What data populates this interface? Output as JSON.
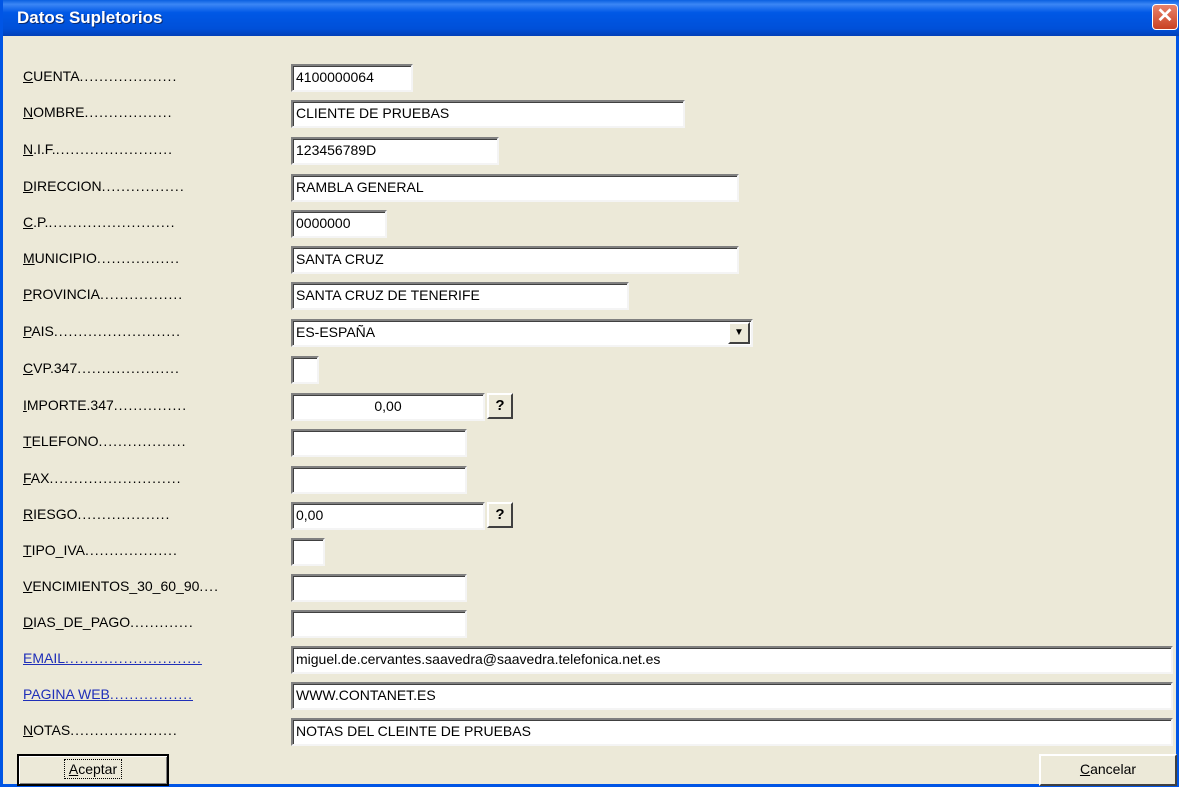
{
  "window": {
    "title": "Datos Supletorios",
    "close_label": "✕"
  },
  "fields": {
    "cuenta": {
      "key": "C",
      "rest": "UENTA",
      "dots": "....................",
      "value": "4100000064"
    },
    "nombre": {
      "key": "N",
      "rest": "OMBRE",
      "dots": "..................",
      "value": "CLIENTE DE PRUEBAS"
    },
    "nif": {
      "key": "N",
      "rest": ".I.F.",
      "dots": "........................",
      "value": "123456789D"
    },
    "direccion": {
      "key": "D",
      "rest": "IRECCION",
      "dots": ".................",
      "value": "RAMBLA GENERAL"
    },
    "cp": {
      "key": "C",
      "rest": ".P.",
      "dots": "..........................",
      "value": "0000000"
    },
    "municipio": {
      "key": "M",
      "rest": "UNICIPIO",
      "dots": ".................",
      "value": "SANTA CRUZ"
    },
    "provincia": {
      "key": "P",
      "rest": "ROVINCIA",
      "dots": ".................",
      "value": "SANTA CRUZ DE TENERIFE"
    },
    "pais": {
      "key": "P",
      "rest": "AIS",
      "dots": "..........................",
      "value": "ES-ESPAÑA",
      "dropdown_icon": "▼"
    },
    "cvp347": {
      "key": "C",
      "rest": "VP.347",
      "dots": ".....................",
      "value": ""
    },
    "importe347": {
      "key": "I",
      "rest": "MPORTE.347",
      "dots": "...............",
      "value": "0,00",
      "help": "?"
    },
    "telefono": {
      "key": "T",
      "rest": "ELEFONO",
      "dots": "..................",
      "value": ""
    },
    "fax": {
      "key": "F",
      "rest": "AX",
      "dots": "...........................",
      "value": ""
    },
    "riesgo": {
      "key": "R",
      "rest": "IESGO",
      "dots": "...................",
      "value": "0,00",
      "help": "?"
    },
    "tipo_iva": {
      "key": "T",
      "rest": "IPO_IVA",
      "dots": "...................",
      "value": ""
    },
    "vencimientos": {
      "key": "V",
      "rest": "ENCIMIENTOS_30_60_90",
      "dots": "....",
      "value": ""
    },
    "dias_pago": {
      "key": "D",
      "rest": "IAS_DE_PAGO",
      "dots": ".............",
      "value": ""
    },
    "email": {
      "text": "EMAIL",
      "dots": "............................",
      "value": "miguel.de.cervantes.saavedra@saavedra.telefonica.net.es"
    },
    "web": {
      "text": "PAGINA WEB",
      "dots": ".................",
      "value": "WWW.CONTANET.ES"
    },
    "notas": {
      "key": "N",
      "rest": "OTAS",
      "dots": "......................",
      "value": "NOTAS DEL CLEINTE DE PRUEBAS"
    }
  },
  "buttons": {
    "accept": {
      "key": "A",
      "rest": "ceptar"
    },
    "cancel": {
      "key": "C",
      "rest": "ancelar"
    }
  }
}
